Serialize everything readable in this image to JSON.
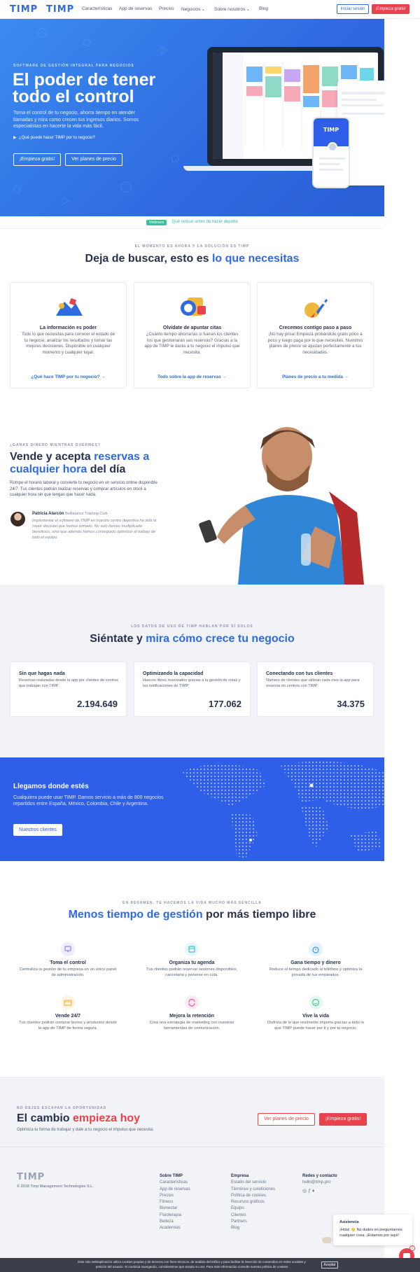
{
  "nav": {
    "logo": "TIMP",
    "logo2": "TIMP",
    "links": [
      "Características",
      "App de reservas",
      "Precios",
      "Negocios",
      "Sobre nosotros",
      "Blog"
    ],
    "login": "Iniciar sesión",
    "signup": "¡Empieza gratis!"
  },
  "hero": {
    "eyebrow": "SOFTWARE DE GESTIÓN INTEGRAL PARA NEGOCIOS",
    "title": "El poder de tener todo el control",
    "desc": "Toma el control de tu negocio, ahorra tiempo en atender llamadas y mira como crecen tus ingresos diarios. Somos especialistas en hacerte la vida más fácil.",
    "video": "¿Qué puede hacer TIMP por tu negocio?",
    "btn_primary": "¡Empieza gratis!",
    "btn_secondary": "Ver planes de precio",
    "phone_brand": "TIMP"
  },
  "beta": {
    "badge": "Webinars",
    "text": "Qué revisar antes de hacer deporte"
  },
  "features": {
    "eyebrow": "EL MOMENTO ES AHORA Y LA SOLUCIÓN ES TIMP",
    "title_a": "Deja de buscar, esto es ",
    "title_b": "lo que necesitas",
    "cards": [
      {
        "title": "La información es poder",
        "desc": "Todo lo que necesitas para conocer el estado de tu negocio, analizar los resultados y tomar las mejores decisiones. Disponible en cualquier momento y cualquier lugar.",
        "link": "¿Qué hace TIMP por tu negocio? →"
      },
      {
        "title": "Olvídate de apuntar citas",
        "desc": "¿Cuánto tiempo ahorrarías si fueran los clientes los que gestionaran sus reservas? Gracias a la app de TIMP le darás a tu negocio el impulso que necesita.",
        "link": "Todo sobre la app de reservas →"
      },
      {
        "title": "Crecemos contigo paso a paso",
        "desc": "¡No hay prisa! Empieza probándolo gratis poco a poco y luego paga por lo que necesites. Nuestros planes de precio se ajustan perfectamente a tus necesidades.",
        "link": "Planes de precio a tu medida →"
      }
    ]
  },
  "sell": {
    "eyebrow": "¿GANAS DINERO MIENTRAS DUERMES?",
    "title_a": "Vende y acepta ",
    "title_b": "reservas a cualquier hora",
    "title_c": " del día",
    "desc": "Rompe el horario laboral y convierte tu negocio en un servicio online disponible 24/7. Tus clientes podrán realizar reservas y comprar artículos en stock a cualquier hora sin que tengas que hacer nada.",
    "author": "Patricia Alarcón",
    "author_org": "BeBalance Training Club",
    "quote": "Implementar el software de TIMP en nuestro centro deportivo ha sido la mejor decisión que hemos tomado. No solo hemos multiplicado beneficios, sino que además hemos conseguido optimizar el trabajo de todo el equipo."
  },
  "stats": {
    "eyebrow": "LOS DATOS DE USO DE TIMP HABLAN POR SÍ SOLOS",
    "title_a": "Siéntate y ",
    "title_b": "mira cómo crece tu negocio",
    "cards": [
      {
        "title": "Sin que hagas nada",
        "desc": "Reservas realizadas desde la app por clientes de centros que trabajan con TIMP",
        "value": "2.194.649"
      },
      {
        "title": "Optimizando la capacidad",
        "desc": "Huecos libres reservados gracias a la gestión de colas y las notificaciones de TIMP",
        "value": "177.062"
      },
      {
        "title": "Conectando con tus clientes",
        "desc": "Número de clientes que utilizan cada mes la app para reservar en centros con TIMP",
        "value": "34.375"
      }
    ]
  },
  "map": {
    "title": "Llegamos donde estés",
    "desc": "Cualquiera puede usar TIMP. Damos servicio a más de 800 negocios repartidos entre España, México, Colombia, Chile y Argentina.",
    "button": "Nuestros clientes"
  },
  "benefits": {
    "eyebrow": "EN RESUMEN, TE HACEMOS LA VIDA MUCHO MÁS SENCILLA",
    "title_a": "Menos tiempo de gestión",
    "title_b": " por más tiempo libre",
    "items": [
      {
        "title": "Toma el control",
        "desc": "Centraliza la gestión de tu empresa en un único panel de administración.",
        "icon": "monitor-icon",
        "color": "#8f83e8"
      },
      {
        "title": "Organiza tu agenda",
        "desc": "Tus clientes podrán reservar sesiones disponibles, cancelarla y ponerse en cola.",
        "icon": "calendar-icon",
        "color": "#3fc3c9"
      },
      {
        "title": "Gana tiempo y dinero",
        "desc": "Reduce el tiempo dedicado al teléfono y optimiza la jornada de tus empleados.",
        "icon": "stopwatch-icon",
        "color": "#3d9af0"
      },
      {
        "title": "Vende 24/7",
        "desc": "Tus clientes podrán comprar bonos y productos desde la app de TIMP de forma segura.",
        "icon": "credit-card-icon",
        "color": "#f0b73d"
      },
      {
        "title": "Mejora la retención",
        "desc": "Crea una estrategia de marketing con nuestras herramientas de comunicación.",
        "icon": "refresh-icon",
        "color": "#e85c9a"
      },
      {
        "title": "Vive la vida",
        "desc": "Disfruta de lo que realmente importa gracias a todo lo que TIMP puede hacer por ti y por tu negocio.",
        "icon": "smile-icon",
        "color": "#4cc98a"
      }
    ]
  },
  "cta": {
    "eyebrow": "NO DEJES ESCAPAR LA OPORTUNIDAD",
    "title_a": "El cambio ",
    "title_b": "empieza hoy",
    "desc": "Optimiza tu forma de trabajar y dale a tu negocio el impulso que necesita.",
    "btn_secondary": "Ver planes de precio",
    "btn_primary": "¡Empieza gratis!"
  },
  "footer": {
    "logo": "TIMP",
    "copyright": "© 2018 Timp Management Technologies S.L.",
    "col1": {
      "heading": "Sobre TIMP",
      "links": [
        "Características",
        "App de reservas",
        "Precios",
        "Fitness",
        "Bienestar",
        "Fisioterapia",
        "Belleza",
        "Academias"
      ]
    },
    "col2": {
      "heading": "Empresa",
      "links": [
        "Estado del servicio",
        "Términos y condiciones",
        "Política de cookies",
        "Recursos gráficos",
        "Equipo",
        "Clientes",
        "Partners",
        "Blog"
      ]
    },
    "col3": {
      "heading": "Redes y contacto",
      "email": "hello@timp.pro"
    }
  },
  "chat": {
    "header": "Asistencia",
    "message": "¡Hola! 👋 No dudes en preguntarnos cualquier cosa. ¡Estamos por aquí!",
    "badge": "1"
  },
  "cookie": {
    "text": "Este sitio web/aplicación utiliza cookies propias y de terceros con fines técnicos, de análisis del tráfico y para facilitar la inserción de contenidos en redes sociales y petición del usuario. Si continúa navegando, consideramos que acepta su uso. Para más información consulte nuestra política de cookies",
    "accept": "Aceptar"
  }
}
